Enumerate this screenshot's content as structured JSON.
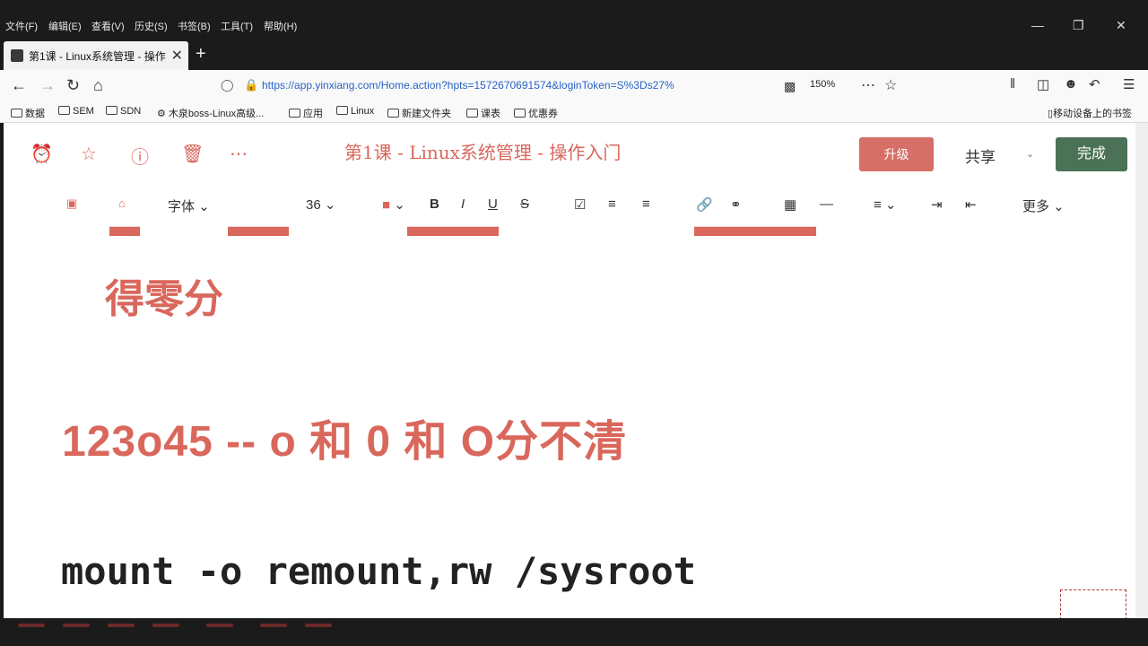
{
  "menubar": [
    "文件(F)",
    "编辑(E)",
    "查看(V)",
    "历史(S)",
    "书签(B)",
    "工具(T)",
    "帮助(H)"
  ],
  "window_controls": {
    "minimize": "—",
    "restore": "❐",
    "close": "✕"
  },
  "tab": {
    "title": "第1课 - Linux系统管理 - 操作",
    "close": "✕"
  },
  "new_tab": "+",
  "nav": {
    "url": "https://app.yinxiang.com/Home.action?hpts=1572670691574&loginToken=S%3Ds27%",
    "zoom": "150%"
  },
  "bookmarks": [
    "数据",
    "SEM",
    "SDN",
    "木泉boss-Linux高级...",
    "应用",
    "Linux",
    "新建文件夹",
    "课表",
    "优惠券"
  ],
  "mobile_bookmarks": "移动设备上的书签",
  "note": {
    "title": "第1课 - Linux系统管理 - 操作入门",
    "upgrade": "升级",
    "share": "共享",
    "done": "完成"
  },
  "toolbar": {
    "font": "字体",
    "size": "36",
    "bold": "B",
    "italic": "I",
    "underline": "U",
    "strike": "S",
    "more": "更多"
  },
  "body": {
    "line1": "得零分",
    "line2": "123o45 -- o 和 0 和 O分不清",
    "line3": "mount -o remount,rw /sysroot"
  },
  "colors": {
    "accent": "#d9675c",
    "done": "#4b7256",
    "upgrade": "#d66f67"
  }
}
